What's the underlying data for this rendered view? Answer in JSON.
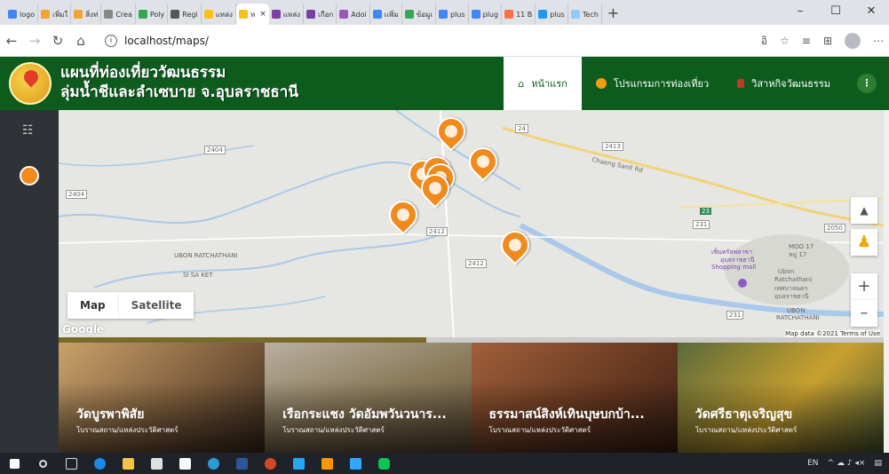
{
  "browser": {
    "tabs": [
      {
        "label": "logo",
        "color": "#4285f4"
      },
      {
        "label": "เพิ่มใ",
        "color": "#f4a234"
      },
      {
        "label": "สิ่งท่",
        "color": "#f4a234"
      },
      {
        "label": "Crea",
        "color": "#888888"
      },
      {
        "label": "Poly",
        "color": "#34a853"
      },
      {
        "label": "Regi",
        "color": "#555555"
      },
      {
        "label": "แหล่ง",
        "color": "#f9c11b"
      },
      {
        "label": "ห",
        "color": "#f9c11b",
        "active": true
      },
      {
        "label": "แหล่ง",
        "color": "#7a3fa0"
      },
      {
        "label": "เกือก",
        "color": "#7a3fa0"
      },
      {
        "label": "Adoi",
        "color": "#9b59b6"
      },
      {
        "label": "เเพิ่ม",
        "color": "#4285f4"
      },
      {
        "label": "ข้อมูเ",
        "color": "#34a853"
      },
      {
        "label": "plus",
        "color": "#4285f4"
      },
      {
        "label": "plug",
        "color": "#4285f4"
      },
      {
        "label": "11 B",
        "color": "#ff7043"
      },
      {
        "label": "plus",
        "color": "#2196f3"
      },
      {
        "label": "Tech",
        "color": "#90caf9"
      }
    ],
    "close_symbol": "×",
    "new_tab": "+",
    "window_controls": [
      "–",
      "☐",
      "✕"
    ],
    "url": "localhost/maps/",
    "translate_icon": "อิ"
  },
  "header": {
    "title_line1": "แผนที่ท่องเที่ยววัฒนธรรม",
    "title_line2": "ลุ่มน้ำชีและลำเซบาย จ.อุบลราชธานี",
    "nav": [
      {
        "label": "หน้าแรก",
        "icon": "home-icon",
        "active": true
      },
      {
        "label": "โปรแกรมการท่องเที่ยว",
        "icon": "program-icon",
        "active": false
      },
      {
        "label": "วิสาหกิจวัฒนธรรม",
        "icon": "enterprise-icon",
        "active": false
      }
    ],
    "menu_symbol": "⋮"
  },
  "sidebar": {
    "filter_icon": "filter-icon",
    "pin_icon": "temple-pin-icon"
  },
  "map": {
    "type_buttons": {
      "map": "Map",
      "satellite": "Satellite"
    },
    "labels": [
      "UBON RATCHATHANI",
      "SI SA KET",
      "เซ็นทรัลพลาซา",
      "อุบลราชธานี",
      "Shopping mall",
      "Ubon",
      "Ratchathani",
      "เทศบาลนคร",
      "อุบลราชธานี",
      "UBON",
      "RATCHATHANI",
      "Chaeng Sanit Rd",
      "MOO 17",
      "หมู่ 17"
    ],
    "road_numbers": [
      "2404",
      "2404",
      "24",
      "2413",
      "2412",
      "2412",
      "231",
      "2050",
      "23",
      "231"
    ],
    "google_label": "Google",
    "attribution": "Map data ©2021   Terms of Use",
    "zoom_in": "+",
    "zoom_out": "–",
    "lock_symbol": "🔒",
    "pegman_symbol": "●",
    "places_pins": 9
  },
  "cards": [
    {
      "title": "วัดบูรพาพิสัย",
      "subtitle": "โบราณสถาน/แหล่งประวัติศาสตร์",
      "bg": "#b08c5c"
    },
    {
      "title": "เรือกระแชง วัดอัมพวันวนาร...",
      "subtitle": "โบราณสถาน/แหล่งประวัติศาสตร์",
      "bg": "#8a7a5a"
    },
    {
      "title": "ธรรมาสน์สิงห์เทินบุษบกบ้า...",
      "subtitle": "โบราณสถาน/แหล่งประวัติศาสตร์",
      "bg": "#7a4a2e"
    },
    {
      "title": "วัดศรีธาตุเจริญสุข",
      "subtitle": "โบราณสถาน/แหล่งประวัติศาสตร์",
      "bg": "#6b7a4a"
    }
  ],
  "taskbar": {
    "apps": [
      "windows-icon",
      "search-icon",
      "taskview-icon",
      "edge-icon",
      "file-explorer-icon",
      "store-icon",
      "mail-icon",
      "chrome-icon",
      "word-icon",
      "powerpoint-icon",
      "vscode-icon",
      "sublime-icon",
      "photoshop-icon",
      "line-icon"
    ],
    "lang": "EN",
    "tray_symbols": "^  ☁  ♪  ◂×"
  }
}
